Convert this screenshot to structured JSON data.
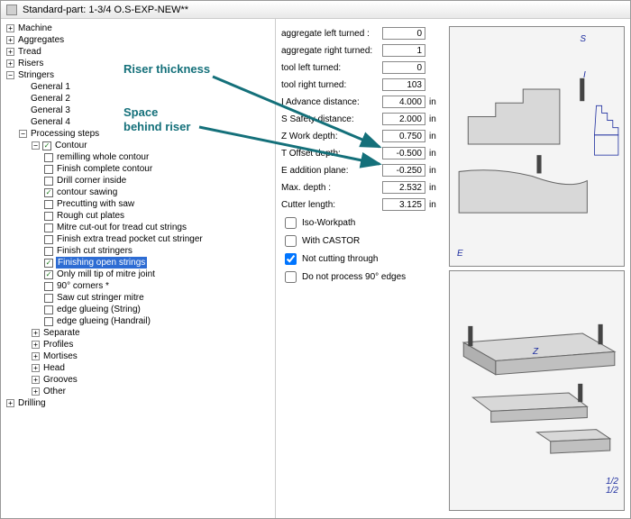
{
  "title": "Standard-part: 1-3/4  O.S-EXP-NEW**",
  "tree": {
    "machine": "Machine",
    "aggregates": "Aggregates",
    "tread": "Tread",
    "risers": "Risers",
    "stringers": "Stringers",
    "general1": "General  1",
    "general2": "General  2",
    "general3": "General  3",
    "general4": "General  4",
    "processing": "Processing steps",
    "contour": "Contour",
    "contour_items": {
      "remilling": "remilling whole contour",
      "finish_complete": "Finish complete contour",
      "drill_corner": "Drill corner inside",
      "contour_sawing": "contour sawing",
      "precutting": "Precutting with saw",
      "rough_cut": "Rough cut plates",
      "mitre_cutout": "Mitre cut-out for tread cut strings",
      "finish_extra": "Finish extra tread pocket cut stringer",
      "finish_cut": "Finish cut stringers",
      "finishing_open": "Finishing open strings",
      "only_mill": "Only mill tip of mitre joint",
      "corners90": "90° corners     *",
      "saw_cut": "Saw cut stringer mitre",
      "edge_glue_s": "edge glueing  (String)",
      "edge_glue_h": "edge glueing  (Handrail)"
    },
    "separate": "Separate",
    "profiles": "Profiles",
    "mortises": "Mortises",
    "head": "Head",
    "grooves": "Grooves",
    "other": "Other",
    "drilling": "Drilling"
  },
  "params": {
    "agg_left": {
      "label": "aggregate left turned :",
      "value": "0"
    },
    "agg_right": {
      "label": "aggregate right turned:",
      "value": "1"
    },
    "tool_left": {
      "label": "tool    left turned:",
      "value": "0"
    },
    "tool_right": {
      "label": "tool    right turned:",
      "value": "103"
    },
    "advance": {
      "label": "I  Advance distance:",
      "value": "4.000",
      "unit": "in"
    },
    "safety": {
      "label": "S  Safety distance:",
      "value": "2.000",
      "unit": "in"
    },
    "work": {
      "label": "Z  Work depth:",
      "value": "0.750",
      "unit": "in"
    },
    "offset": {
      "label": "T  Offset depth:",
      "value": "-0.500",
      "unit": "in"
    },
    "addition": {
      "label": "E  addition plane:",
      "value": "-0.250",
      "unit": "in"
    },
    "max": {
      "label": "Max. depth       :",
      "value": "2.532",
      "unit": "in"
    },
    "cutter": {
      "label": "Cutter length:",
      "value": "3.125",
      "unit": "in"
    }
  },
  "checks": {
    "iso": "Iso-Workpath",
    "castor": "With CASTOR",
    "notcut": "Not cutting through",
    "donot90": "Do not process 90° edges"
  },
  "annot": {
    "riser": "Riser thickness",
    "space1": "Space",
    "space2": "behind riser"
  },
  "diag": {
    "S": "S",
    "I": "I",
    "E": "E",
    "Z": "Z",
    "half": "1/2"
  }
}
